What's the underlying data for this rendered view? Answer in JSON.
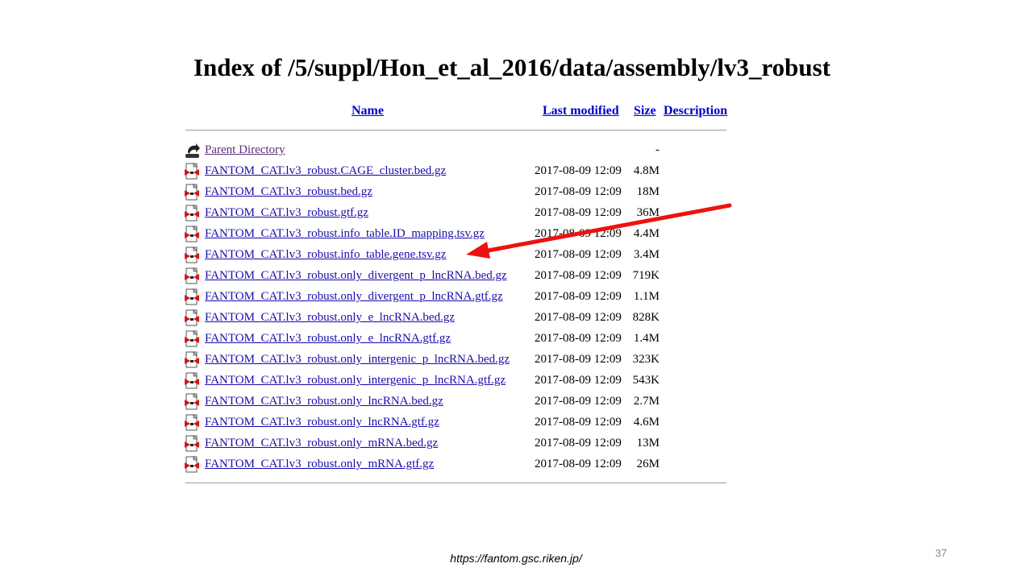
{
  "page_title": "Index of /5/suppl/Hon_et_al_2016/data/assembly/lv3_robust",
  "columns": {
    "name": "Name",
    "last_modified": "Last modified",
    "size": "Size",
    "description": "Description"
  },
  "parent": {
    "label": "Parent Directory",
    "size": "-",
    "icon": "back-icon"
  },
  "files": [
    {
      "name": "FANTOM_CAT.lv3_robust.CAGE_cluster.bed.gz",
      "date": "2017-08-09 12:09",
      "size": "4.8M"
    },
    {
      "name": "FANTOM_CAT.lv3_robust.bed.gz",
      "date": "2017-08-09 12:09",
      "size": "18M"
    },
    {
      "name": "FANTOM_CAT.lv3_robust.gtf.gz",
      "date": "2017-08-09 12:09",
      "size": "36M"
    },
    {
      "name": "FANTOM_CAT.lv3_robust.info_table.ID_mapping.tsv.gz",
      "date": "2017-08-09 12:09",
      "size": "4.4M"
    },
    {
      "name": "FANTOM_CAT.lv3_robust.info_table.gene.tsv.gz",
      "date": "2017-08-09 12:09",
      "size": "3.4M"
    },
    {
      "name": "FANTOM_CAT.lv3_robust.only_divergent_p_lncRNA.bed.gz",
      "date": "2017-08-09 12:09",
      "size": "719K"
    },
    {
      "name": "FANTOM_CAT.lv3_robust.only_divergent_p_lncRNA.gtf.gz",
      "date": "2017-08-09 12:09",
      "size": "1.1M"
    },
    {
      "name": "FANTOM_CAT.lv3_robust.only_e_lncRNA.bed.gz",
      "date": "2017-08-09 12:09",
      "size": "828K"
    },
    {
      "name": "FANTOM_CAT.lv3_robust.only_e_lncRNA.gtf.gz",
      "date": "2017-08-09 12:09",
      "size": "1.4M"
    },
    {
      "name": "FANTOM_CAT.lv3_robust.only_intergenic_p_lncRNA.bed.gz",
      "date": "2017-08-09 12:09",
      "size": "323K"
    },
    {
      "name": "FANTOM_CAT.lv3_robust.only_intergenic_p_lncRNA.gtf.gz",
      "date": "2017-08-09 12:09",
      "size": "543K"
    },
    {
      "name": "FANTOM_CAT.lv3_robust.only_lncRNA.bed.gz",
      "date": "2017-08-09 12:09",
      "size": "2.7M"
    },
    {
      "name": "FANTOM_CAT.lv3_robust.only_lncRNA.gtf.gz",
      "date": "2017-08-09 12:09",
      "size": "4.6M"
    },
    {
      "name": "FANTOM_CAT.lv3_robust.only_mRNA.bed.gz",
      "date": "2017-08-09 12:09",
      "size": "13M"
    },
    {
      "name": "FANTOM_CAT.lv3_robust.only_mRNA.gtf.gz",
      "date": "2017-08-09 12:09",
      "size": "26M"
    }
  ],
  "file_icon": "compressed-file-icon",
  "annotation": {
    "icon": "red-arrow-icon",
    "color": "#ee1111",
    "points_to": "FANTOM_CAT.lv3_robust.info_table.gene.tsv.gz"
  },
  "footer_url": "https://fantom.gsc.riken.jp/",
  "slide_number": "37",
  "colors": {
    "link": "#1a0dab",
    "visited": "#5a2d7a",
    "header_link": "#0000cc",
    "rule": "#9a9a9a"
  }
}
